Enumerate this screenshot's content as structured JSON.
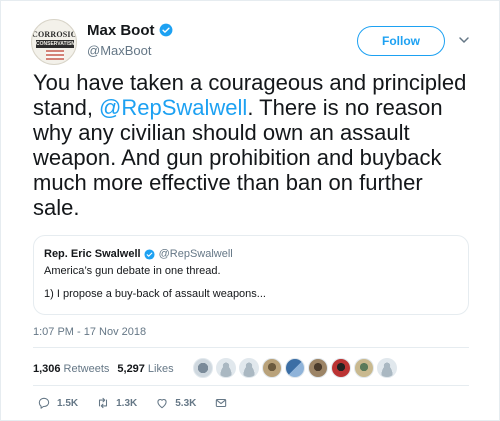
{
  "author": {
    "name": "Max Boot",
    "handle": "@MaxBoot",
    "avatar_text_top": "CORROSION",
    "avatar_text_bottom": "CONSERVATISM"
  },
  "follow_button": {
    "label": "Follow"
  },
  "tweet": {
    "text_before": "You have taken a courageous and principled stand, ",
    "mention": "@RepSwalwell",
    "text_after": ". There is no reason why any civilian should own an assault weapon. And gun prohibition and buyback much more effective than ban on further sale."
  },
  "quoted_tweet": {
    "name": "Rep. Eric Swalwell",
    "handle": "@RepSwalwell",
    "line1": "America’s gun debate in one thread.",
    "line2": "1) I propose a buy-back of assault weapons..."
  },
  "timestamp": "1:07 PM - 17 Nov 2018",
  "stats": {
    "retweets_count": "1,306",
    "retweets_label": "Retweets",
    "likes_count": "5,297",
    "likes_label": "Likes"
  },
  "actions": {
    "reply_count": "1.5K",
    "retweet_count": "1.3K",
    "like_count": "5.3K"
  },
  "colors": {
    "accent": "#1da1f2",
    "text": "#14171a",
    "muted": "#657786",
    "border": "#e6ecf0"
  },
  "icons": [
    "verified-badge-icon",
    "chevron-down-icon",
    "reply-icon",
    "retweet-icon",
    "like-icon",
    "direct-message-icon"
  ]
}
